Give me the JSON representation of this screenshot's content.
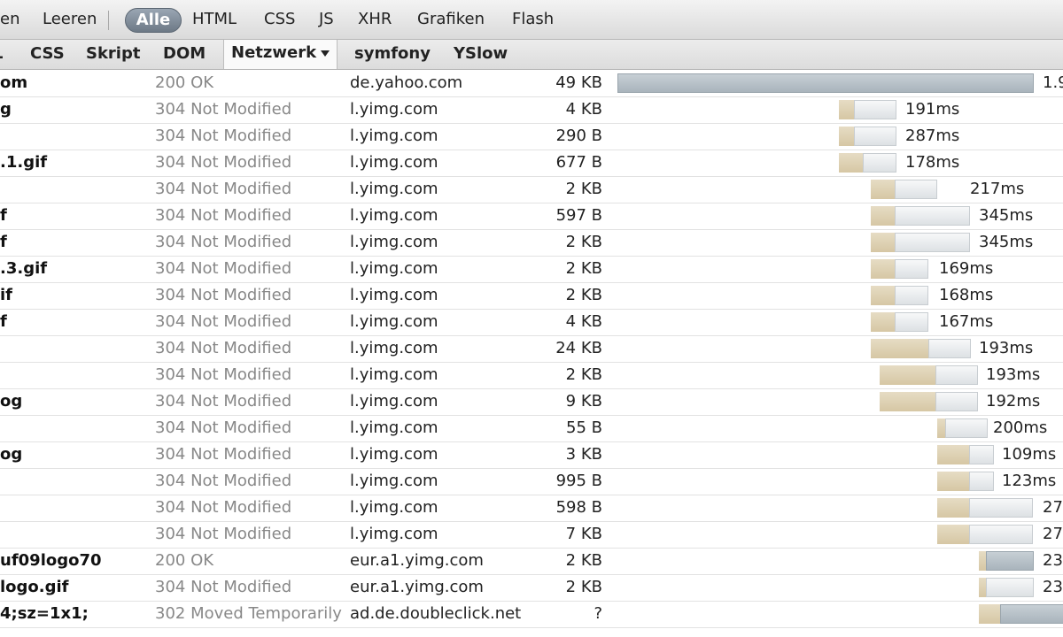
{
  "toolbar": {
    "items": [
      "en",
      "Leeren",
      "Alle",
      "HTML",
      "CSS",
      "JS",
      "XHR",
      "Grafiken",
      "Flash"
    ],
    "active": "Alle"
  },
  "tabs": [
    "L",
    "CSS",
    "Skript",
    "DOM",
    "Netzwerk",
    "symfony",
    "YSlow"
  ],
  "selected_tab": "Netzwerk",
  "requests": [
    {
      "file": "om",
      "status": "200 OK",
      "domain": "de.yahoo.com",
      "size": "49 KB",
      "time": "1.9"
    },
    {
      "file": "g",
      "status": "304 Not Modified",
      "domain": "l.yimg.com",
      "size": "4 KB",
      "time": "191ms"
    },
    {
      "file": "",
      "status": "304 Not Modified",
      "domain": "l.yimg.com",
      "size": "290 B",
      "time": "287ms"
    },
    {
      "file": ".1.gif",
      "status": "304 Not Modified",
      "domain": "l.yimg.com",
      "size": "677 B",
      "time": "178ms"
    },
    {
      "file": "",
      "status": "304 Not Modified",
      "domain": "l.yimg.com",
      "size": "2 KB",
      "time": "217ms"
    },
    {
      "file": "f",
      "status": "304 Not Modified",
      "domain": "l.yimg.com",
      "size": "597 B",
      "time": "345ms"
    },
    {
      "file": "f",
      "status": "304 Not Modified",
      "domain": "l.yimg.com",
      "size": "2 KB",
      "time": "345ms"
    },
    {
      "file": ".3.gif",
      "status": "304 Not Modified",
      "domain": "l.yimg.com",
      "size": "2 KB",
      "time": "169ms"
    },
    {
      "file": "if",
      "status": "304 Not Modified",
      "domain": "l.yimg.com",
      "size": "2 KB",
      "time": "168ms"
    },
    {
      "file": "f",
      "status": "304 Not Modified",
      "domain": "l.yimg.com",
      "size": "4 KB",
      "time": "167ms"
    },
    {
      "file": "",
      "status": "304 Not Modified",
      "domain": "l.yimg.com",
      "size": "24 KB",
      "time": "193ms"
    },
    {
      "file": "",
      "status": "304 Not Modified",
      "domain": "l.yimg.com",
      "size": "2 KB",
      "time": "193ms"
    },
    {
      "file": "og",
      "status": "304 Not Modified",
      "domain": "l.yimg.com",
      "size": "9 KB",
      "time": "192ms"
    },
    {
      "file": "",
      "status": "304 Not Modified",
      "domain": "l.yimg.com",
      "size": "55 B",
      "time": "200ms"
    },
    {
      "file": "og",
      "status": "304 Not Modified",
      "domain": "l.yimg.com",
      "size": "3 KB",
      "time": "109ms"
    },
    {
      "file": "",
      "status": "304 Not Modified",
      "domain": "l.yimg.com",
      "size": "995 B",
      "time": "123ms"
    },
    {
      "file": "",
      "status": "304 Not Modified",
      "domain": "l.yimg.com",
      "size": "598 B",
      "time": "27"
    },
    {
      "file": "",
      "status": "304 Not Modified",
      "domain": "l.yimg.com",
      "size": "7 KB",
      "time": "27"
    },
    {
      "file": "uf09logo70",
      "status": "200 OK",
      "domain": "eur.a1.yimg.com",
      "size": "2 KB",
      "time": "23"
    },
    {
      "file": "logo.gif",
      "status": "304 Not Modified",
      "domain": "eur.a1.yimg.com",
      "size": "2 KB",
      "time": "23"
    },
    {
      "file": "4;sz=1x1;",
      "status": "302 Moved Temporarily",
      "domain": "ad.de.doubleclick.net",
      "size": "?",
      "time": ""
    }
  ]
}
